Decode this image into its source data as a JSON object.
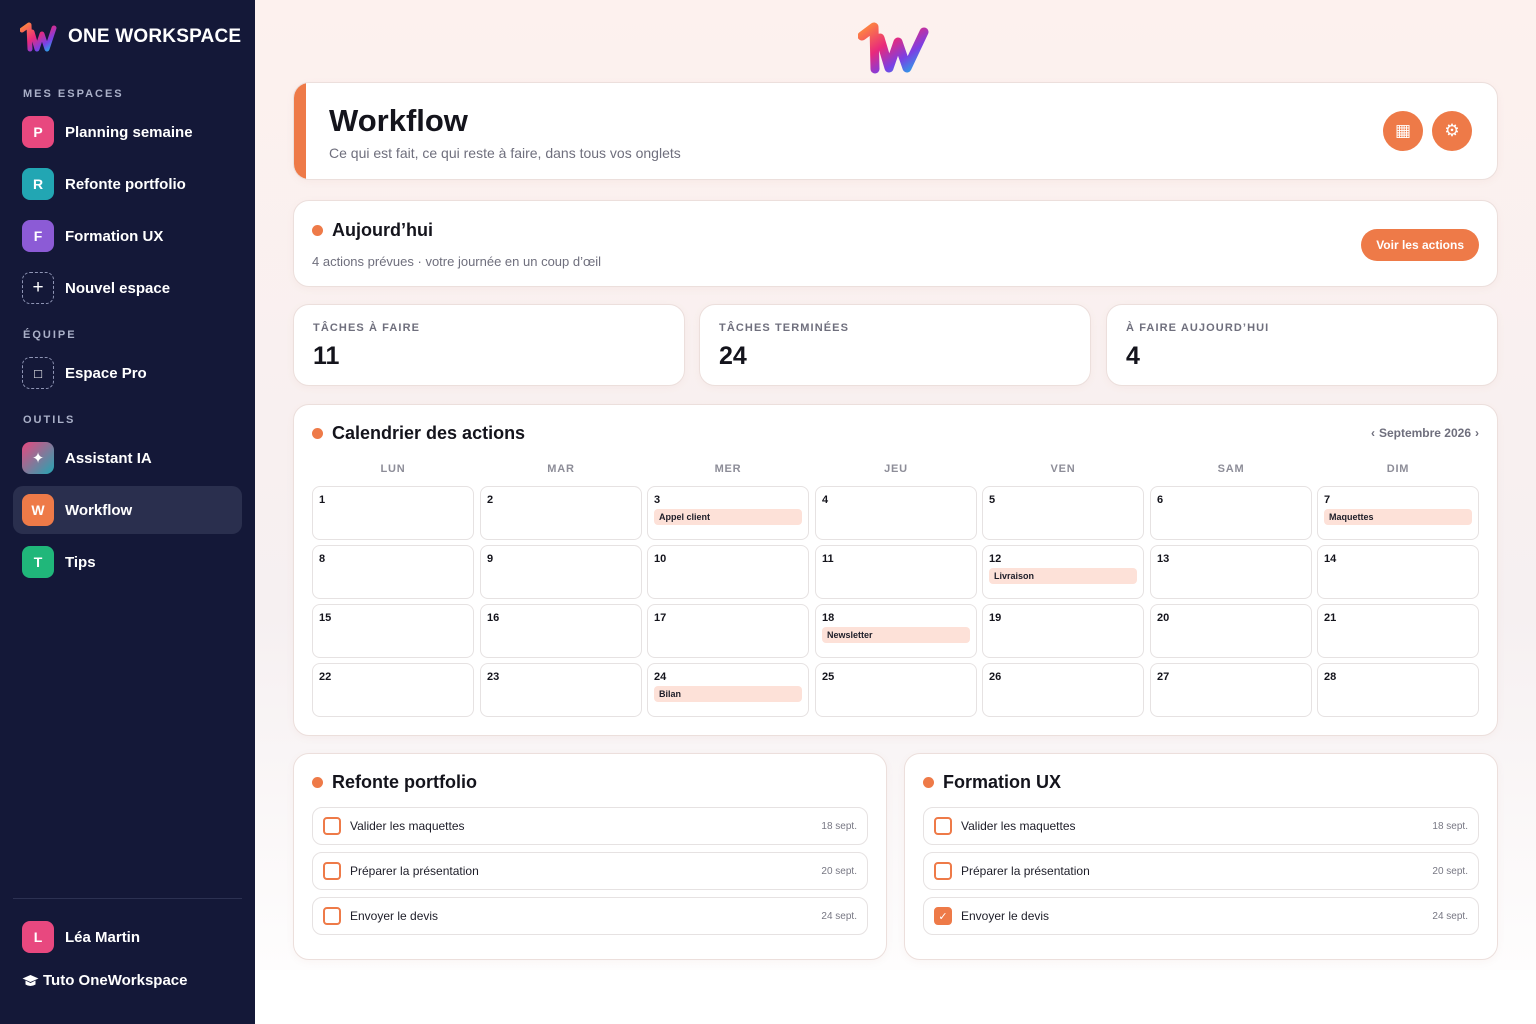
{
  "brand": {
    "name": "ONE WORKSPACE"
  },
  "sidebar": {
    "sections": {
      "spaces": "MES ESPACES",
      "team": "ÉQUIPE",
      "tools": "OUTILS"
    },
    "spaces": [
      {
        "letter": "P",
        "label": "Planning semaine",
        "color": "#e8487f"
      },
      {
        "letter": "R",
        "label": "Refonte portfolio",
        "color": "#22a6b3"
      },
      {
        "letter": "F",
        "label": "Formation UX",
        "color": "#8c5bd6"
      },
      {
        "letter": "+",
        "label": "Nouvel espace",
        "icon": "plus-icon"
      }
    ],
    "team": [
      {
        "letter": "□",
        "label": "Espace Pro",
        "icon": "square-icon"
      }
    ],
    "tools": [
      {
        "letter": "✦",
        "label": "Assistant IA",
        "icon": "sparkle-icon"
      },
      {
        "letter": "W",
        "label": "Workflow",
        "color": "#ee7a48",
        "active": true
      },
      {
        "letter": "T",
        "label": "Tips",
        "color": "#20b77a"
      }
    ],
    "user": {
      "letter": "L",
      "name": "Léa Martin",
      "color": "#e8487f"
    },
    "tuto": "Tuto OneWorkspace",
    "tuto_icon": "graduation-cap-icon"
  },
  "header": {
    "title": "Workflow",
    "subtitle": "Ce qui est fait, ce qui reste à faire, dans tous vos onglets",
    "buttons": [
      {
        "icon": "calendar-icon",
        "glyph": "▦"
      },
      {
        "icon": "gear-icon",
        "glyph": "⚙"
      }
    ]
  },
  "today": {
    "title": "Aujourd’hui",
    "subtitle": "4 actions prévues · votre journée en un coup d’œil",
    "button": "Voir les actions"
  },
  "stats": [
    {
      "label": "TÂCHES À FAIRE",
      "value": "11"
    },
    {
      "label": "TÂCHES TERMINÉES",
      "value": "24"
    },
    {
      "label": "À FAIRE AUJOURD’HUI",
      "value": "4"
    }
  ],
  "calendar": {
    "title": "Calendrier des actions",
    "prev": "‹",
    "month": "Septembre 2026",
    "next": "›",
    "weekdays": [
      "LUN",
      "MAR",
      "MER",
      "JEU",
      "VEN",
      "SAM",
      "DIM"
    ],
    "days": [
      {
        "num": "1"
      },
      {
        "num": "2"
      },
      {
        "num": "3",
        "event": "Appel client"
      },
      {
        "num": "4"
      },
      {
        "num": "5"
      },
      {
        "num": "6"
      },
      {
        "num": "7",
        "event": "Maquettes"
      },
      {
        "num": "8"
      },
      {
        "num": "9"
      },
      {
        "num": "10"
      },
      {
        "num": "11"
      },
      {
        "num": "12",
        "event": "Livraison"
      },
      {
        "num": "13"
      },
      {
        "num": "14"
      },
      {
        "num": "15"
      },
      {
        "num": "16"
      },
      {
        "num": "17"
      },
      {
        "num": "18",
        "event": "Newsletter"
      },
      {
        "num": "19"
      },
      {
        "num": "20"
      },
      {
        "num": "21"
      },
      {
        "num": "22"
      },
      {
        "num": "23"
      },
      {
        "num": "24",
        "event": "Bilan"
      },
      {
        "num": "25"
      },
      {
        "num": "26"
      },
      {
        "num": "27"
      },
      {
        "num": "28"
      }
    ]
  },
  "lists": [
    {
      "title": "Refonte portfolio",
      "tasks": [
        {
          "label": "Valider les maquettes",
          "date": "18 sept.",
          "done": false
        },
        {
          "label": "Préparer la présentation",
          "date": "20 sept.",
          "done": false
        },
        {
          "label": "Envoyer le devis",
          "date": "24 sept.",
          "done": false
        }
      ]
    },
    {
      "title": "Formation UX",
      "tasks": [
        {
          "label": "Valider les maquettes",
          "date": "18 sept.",
          "done": false
        },
        {
          "label": "Préparer la présentation",
          "date": "20 sept.",
          "done": false
        },
        {
          "label": "Envoyer le devis",
          "date": "24 sept.",
          "done": true
        }
      ]
    }
  ],
  "colors": {
    "accent": "#ee7a48",
    "sidebar": "#141838",
    "event": "#fde1d8"
  }
}
